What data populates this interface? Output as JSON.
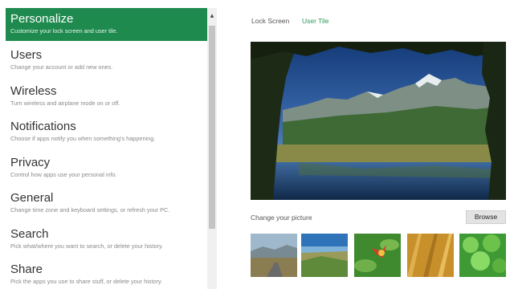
{
  "settings_nav": {
    "items": [
      {
        "title": "Personalize",
        "subtitle": "Customize your lock screen and user tile."
      },
      {
        "title": "Users",
        "subtitle": "Change your account or add new ones."
      },
      {
        "title": "Wireless",
        "subtitle": "Turn wireless and airplane mode on or off."
      },
      {
        "title": "Notifications",
        "subtitle": "Choose if apps notify you when something's happening."
      },
      {
        "title": "Privacy",
        "subtitle": "Control how apps use your personal info."
      },
      {
        "title": "General",
        "subtitle": "Change time zone and keyboard settings, or refresh your PC."
      },
      {
        "title": "Search",
        "subtitle": "Pick what/where you want to search, or delete your history."
      },
      {
        "title": "Share",
        "subtitle": "Pick the apps you use to share stuff, or delete your history."
      }
    ],
    "selected_index": 0
  },
  "scrollbar": {
    "up_arrow": "▴"
  },
  "tabs": {
    "lock_screen": "Lock Screen",
    "user_tile": "User Tile"
  },
  "picture": {
    "change_label": "Change your picture",
    "browse_label": "Browse"
  },
  "thumbnails": [
    "road-landscape",
    "beach-dunes",
    "red-flower",
    "golden-grass",
    "green-clover"
  ],
  "colors": {
    "accent": "#1e8a4e",
    "selected_tab": "#2a9a57",
    "subtitle_text": "#8a8a8a",
    "title_text": "#333333"
  }
}
